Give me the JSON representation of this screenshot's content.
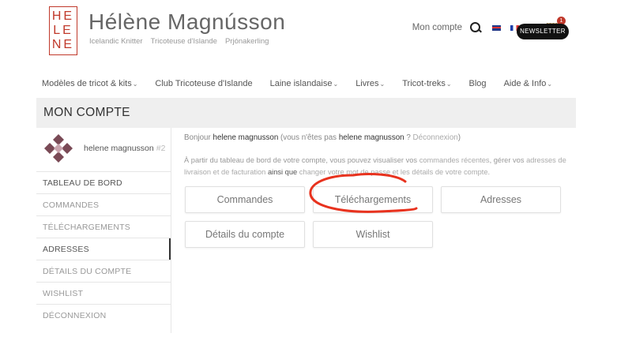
{
  "site": {
    "logo_lines": [
      "HE",
      "LE",
      "NE"
    ],
    "title": "Hélène Magnússon",
    "taglines": [
      "Icelandic Knitter",
      "Tricoteuse d'Islande",
      "Prjónakerling"
    ]
  },
  "header": {
    "account_label": "Mon compte",
    "cart_count": "1",
    "newsletter_label": "NEWSLETTER"
  },
  "nav": [
    {
      "label": "Modèles de tricot & kits",
      "dropdown": true
    },
    {
      "label": "Club Tricoteuse d'Islande",
      "dropdown": false
    },
    {
      "label": "Laine islandaise",
      "dropdown": true
    },
    {
      "label": "Livres",
      "dropdown": true
    },
    {
      "label": "Tricot-treks",
      "dropdown": true
    },
    {
      "label": "Blog",
      "dropdown": false
    },
    {
      "label": "Aide & Info",
      "dropdown": true
    }
  ],
  "page_title": "MON COMPTE",
  "user": {
    "name": "helene magnusson",
    "number": "#2"
  },
  "sidebar": [
    {
      "label": "TABLEAU DE BORD"
    },
    {
      "label": "COMMANDES"
    },
    {
      "label": "TÉLÉCHARGEMENTS"
    },
    {
      "label": "ADRESSES"
    },
    {
      "label": "DÉTAILS DU COMPTE"
    },
    {
      "label": "WISHLIST"
    },
    {
      "label": "DÉCONNEXION"
    }
  ],
  "greeting": {
    "prefix": "Bonjour",
    "name": "helene magnusson",
    "middle": "(vous n'êtes pas",
    "name2": "helene magnusson",
    "suffix": "?",
    "logout": "Déconnexion",
    "close": ")"
  },
  "intro": {
    "p1": "À partir du tableau de bord de votre compte, vous pouvez visualiser vos",
    "link1": "commandes récentes",
    "p2": ", gérer vos",
    "link2": "adresses de livraison et de facturation",
    "p3": "ainsi que",
    "link3": "changer votre mot de passe et les détails de votre compte",
    "p4": "."
  },
  "tiles": [
    {
      "label": "Commandes"
    },
    {
      "label": "Téléchargements"
    },
    {
      "label": "Adresses"
    },
    {
      "label": "Détails du compte"
    },
    {
      "label": "Wishlist"
    }
  ],
  "colors": {
    "brand": "#c0392b",
    "annotation": "#e8321e"
  }
}
